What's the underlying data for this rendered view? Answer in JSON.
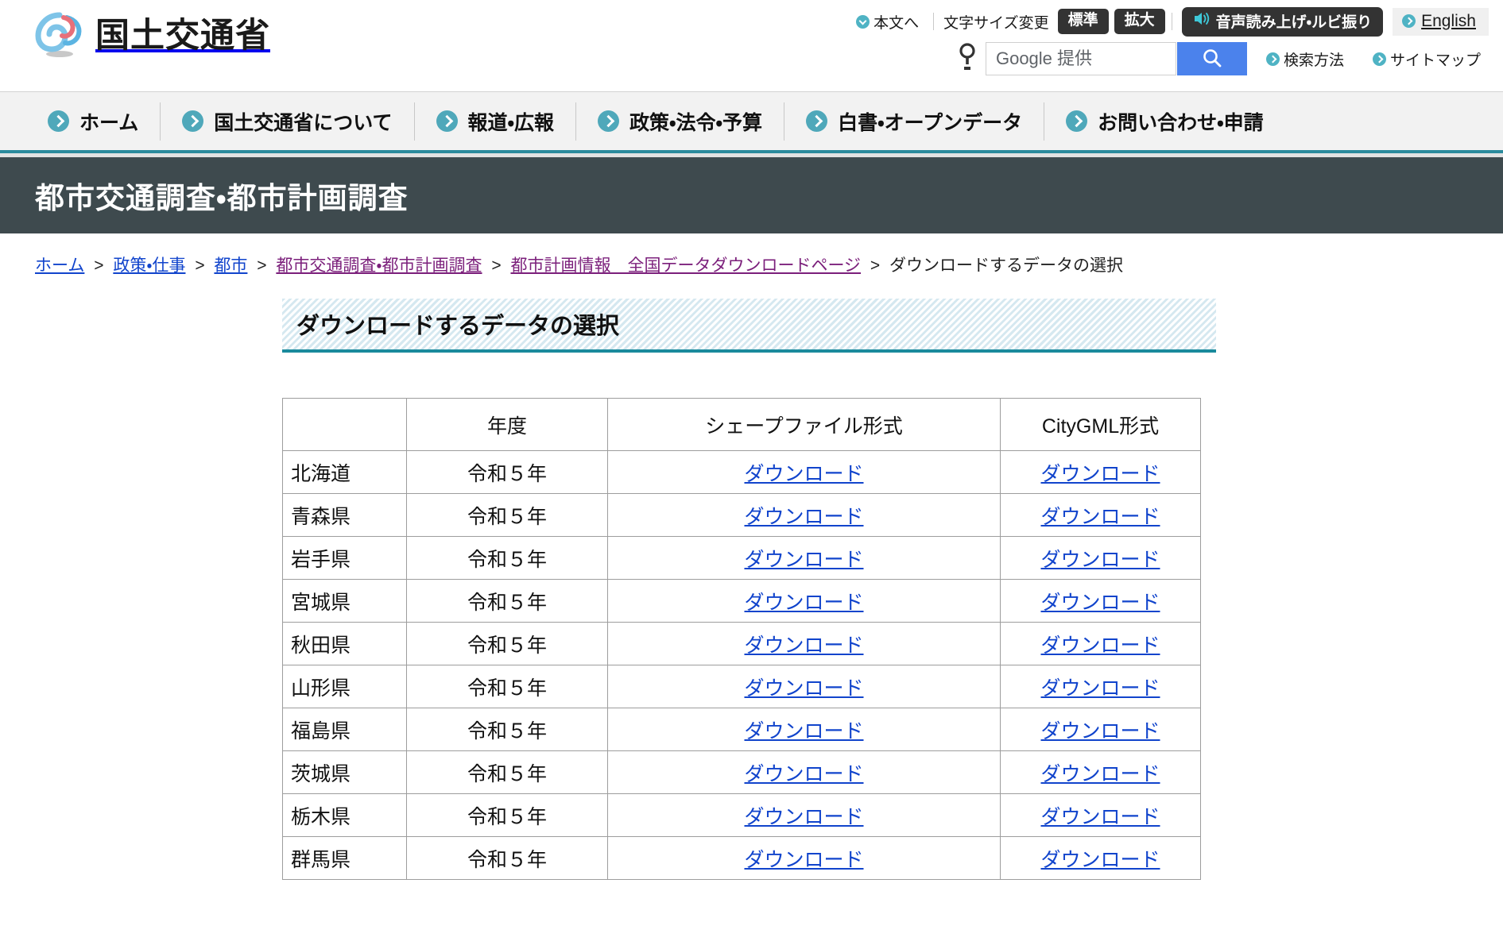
{
  "site": {
    "logo_text": "国土交通省",
    "logo_icon": "mlit-logo-icon"
  },
  "utility": {
    "skip_to_content": "本文へ",
    "font_size_label": "文字サイズ変更",
    "font_size_normal": "標準",
    "font_size_large": "拡大",
    "speech_button": "音声読み上げ・ルビ振り",
    "english": "English"
  },
  "search": {
    "placeholder": "Google 提供",
    "button_icon": "search-icon",
    "how_to_search": "検索方法",
    "sitemap": "サイトマップ"
  },
  "globalnav": {
    "items": [
      {
        "label": "ホーム"
      },
      {
        "label": "国土交通省について"
      },
      {
        "label": "報道・広報"
      },
      {
        "label": "政策・法令・予算"
      },
      {
        "label": "白書・オープンデータ"
      },
      {
        "label": "お問い合わせ・申請"
      }
    ]
  },
  "page": {
    "title": "都市交通調査・都市計画調査",
    "section_heading": "ダウンロードするデータの選択"
  },
  "breadcrumb": [
    {
      "label": "ホーム",
      "state": "unvisited",
      "link": true
    },
    {
      "label": "政策・仕事",
      "state": "unvisited",
      "link": true
    },
    {
      "label": "都市",
      "state": "unvisited",
      "link": true
    },
    {
      "label": "都市交通調査・都市計画調査",
      "state": "visited",
      "link": true
    },
    {
      "label": "都市計画情報　全国データダウンロードページ",
      "state": "visited",
      "link": true
    },
    {
      "label": "ダウンロードするデータの選択",
      "state": "current",
      "link": false
    }
  ],
  "table": {
    "headers": [
      "",
      "年度",
      "シェープファイル形式",
      "CityGML形式"
    ],
    "download_label": "ダウンロード",
    "rows": [
      {
        "pref": "北海道",
        "year": "令和５年",
        "shape": "ダウンロード",
        "citygml": "ダウンロード"
      },
      {
        "pref": "青森県",
        "year": "令和５年",
        "shape": "ダウンロード",
        "citygml": "ダウンロード"
      },
      {
        "pref": "岩手県",
        "year": "令和５年",
        "shape": "ダウンロード",
        "citygml": "ダウンロード"
      },
      {
        "pref": "宮城県",
        "year": "令和５年",
        "shape": "ダウンロード",
        "citygml": "ダウンロード"
      },
      {
        "pref": "秋田県",
        "year": "令和５年",
        "shape": "ダウンロード",
        "citygml": "ダウンロード"
      },
      {
        "pref": "山形県",
        "year": "令和５年",
        "shape": "ダウンロード",
        "citygml": "ダウンロード"
      },
      {
        "pref": "福島県",
        "year": "令和５年",
        "shape": "ダウンロード",
        "citygml": "ダウンロード"
      },
      {
        "pref": "茨城県",
        "year": "令和５年",
        "shape": "ダウンロード",
        "citygml": "ダウンロード"
      },
      {
        "pref": "栃木県",
        "year": "令和５年",
        "shape": "ダウンロード",
        "citygml": "ダウンロード"
      },
      {
        "pref": "群馬県",
        "year": "令和５年",
        "shape": "ダウンロード",
        "citygml": "ダウンロード"
      }
    ]
  },
  "colors": {
    "brand_teal": "#2b8a9c",
    "nav_chevron": "#4fa8ba",
    "title_band": "#3e4a4e",
    "link_blue": "#1144cc",
    "link_visited": "#7b1f7b",
    "search_button": "#4b82ec"
  }
}
